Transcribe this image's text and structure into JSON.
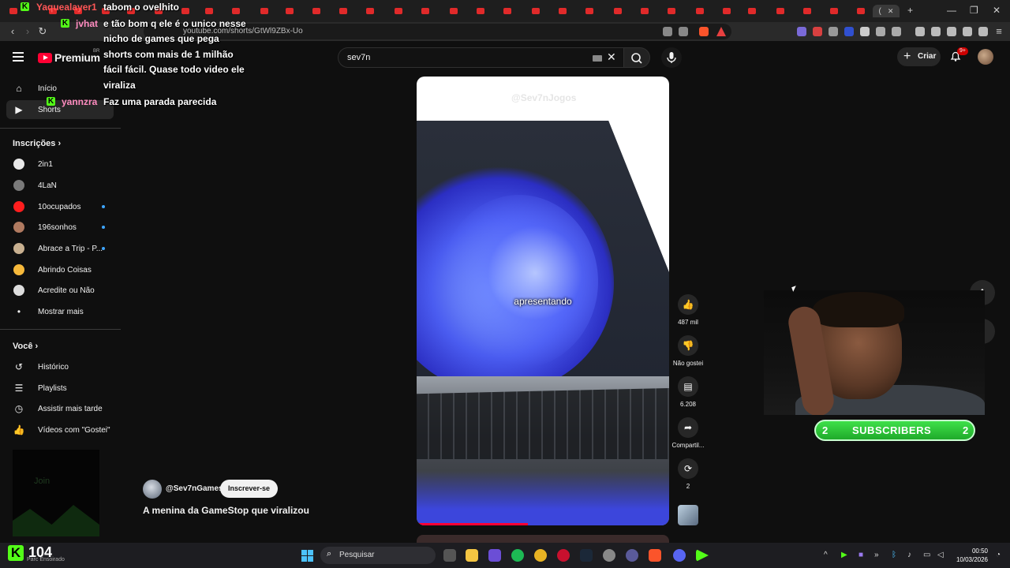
{
  "browser": {
    "url": "youtube.com/shorts/GtWl9ZBx-Uo",
    "active_tab_label": "(",
    "window_controls": [
      "—",
      "❐",
      "✕"
    ]
  },
  "chat": {
    "messages": [
      {
        "user": "Yaquealayer1",
        "user_color": "#ff5757",
        "lines": [
          "tabom o ovelhito"
        ]
      },
      {
        "user": "jvhat",
        "user_color": "#ff8cc0",
        "lines": [
          "e tão bom q ele é o unico nesse",
          "nicho de games que pega",
          "shorts com mais de 1 milhão",
          "fácil fácil. Quase todo video ele",
          "viraliza"
        ]
      },
      {
        "user": "yannzra",
        "user_color": "#ff8cc0",
        "lines": [
          "Faz uma parada parecida"
        ]
      }
    ]
  },
  "header": {
    "logo_text": "Premium",
    "logo_region": "BR",
    "search_query": "sev7n",
    "create_label": "Criar",
    "notifications_badge": "9+"
  },
  "sidebar": {
    "main": [
      {
        "label": "Início",
        "icon": "home-icon"
      },
      {
        "label": "Shorts",
        "icon": "shorts-icon",
        "active": true
      }
    ],
    "subscriptions_title": "Inscrições",
    "subscriptions": [
      {
        "label": "2in1",
        "avatar_color": "#e8e8e8",
        "new": false
      },
      {
        "label": "4LaN",
        "avatar_color": "#7a7a7a",
        "new": false
      },
      {
        "label": "10ocupados",
        "avatar_color": "#ff1e1e",
        "new": true
      },
      {
        "label": "196sonhos",
        "avatar_color": "#b07a60",
        "new": true
      },
      {
        "label": "Abrace a Trip - P...",
        "avatar_color": "#c8b090",
        "new": true
      },
      {
        "label": "Abrindo Coisas",
        "avatar_color": "#f6b93b",
        "new": false
      },
      {
        "label": "Acredite ou Não",
        "avatar_color": "#dddddd",
        "new": false
      }
    ],
    "show_more_label": "Mostrar mais",
    "you_title": "Você",
    "you_items": [
      {
        "label": "Histórico",
        "icon": "history-icon"
      },
      {
        "label": "Playlists",
        "icon": "playlists-icon"
      },
      {
        "label": "Assistir mais tarde",
        "icon": "watch-later-icon"
      },
      {
        "label": "Vídeos com \"Gostei\"",
        "icon": "like-icon"
      }
    ]
  },
  "short": {
    "watermark": "@Sev7nJogos",
    "caption": "apresentando",
    "progress_fraction": 0.44,
    "channel_name": "@Sev7nGames",
    "subscribe_label": "Inscrever-se",
    "title": "A menina da GameStop que viralizou",
    "actions": [
      {
        "icon": "like-icon",
        "label": "487 mil"
      },
      {
        "icon": "dislike-icon",
        "label": "Não gostei"
      },
      {
        "icon": "comments-icon",
        "label": "6.208"
      },
      {
        "icon": "share-icon",
        "label": "Compartil..."
      },
      {
        "icon": "remix-icon",
        "label": "2"
      }
    ]
  },
  "overlay": {
    "subscribers_label": "SUBSCRIBERS",
    "subscribers_left": "2",
    "subscribers_right": "2",
    "kick_join": "Join",
    "viewer_count": "104",
    "viewer_sub": "Parc Ensoirado"
  },
  "taskbar": {
    "search_label": "Pesquisar",
    "time": "00:50",
    "date": "10/03/2026"
  }
}
